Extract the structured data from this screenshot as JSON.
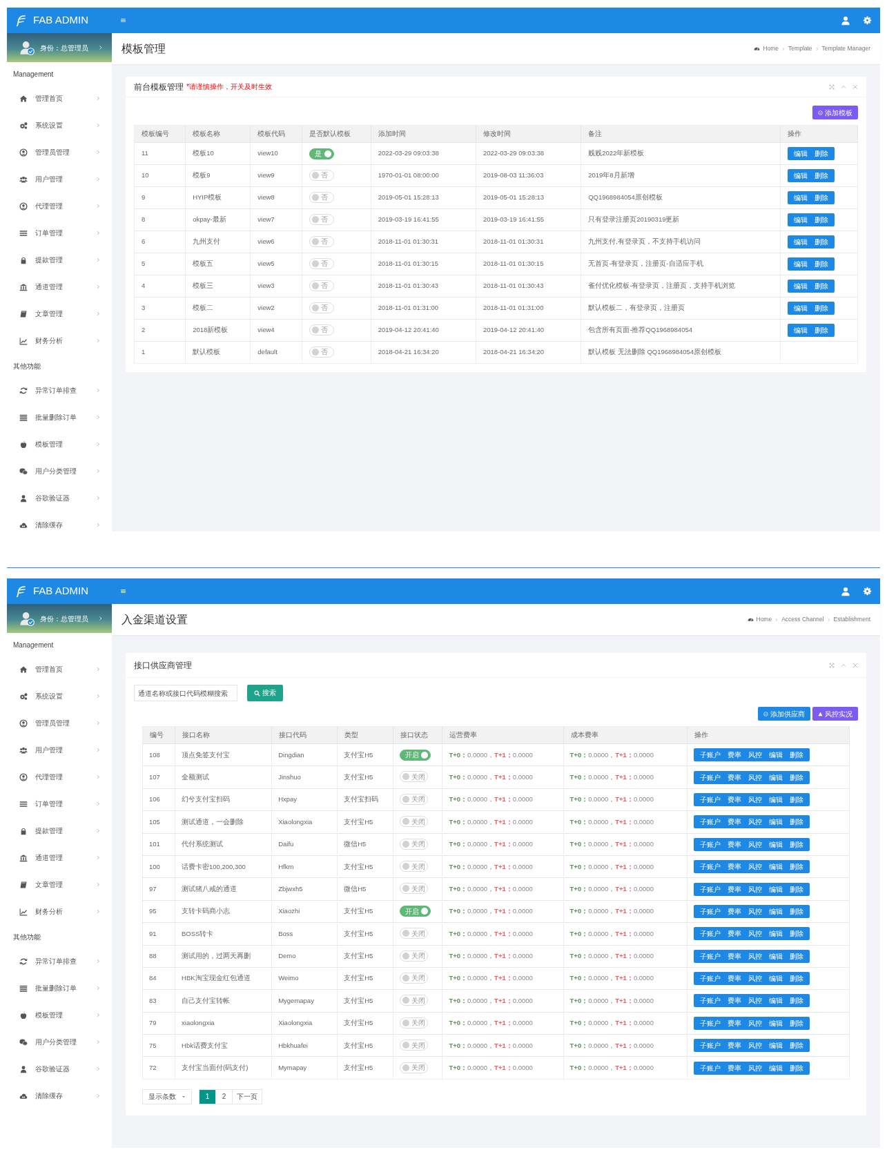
{
  "screens": [
    {
      "brand": "FAB ADMIN",
      "identity": "身份：总管理员",
      "sidebar": [
        {
          "heading": "Management",
          "items": [
            "管理首页",
            "系统设置",
            "管理员管理",
            "用户管理",
            "代理管理",
            "订单管理",
            "提款管理",
            "通道管理",
            "文章管理",
            "财务分析"
          ]
        },
        {
          "heading": "其他功能",
          "items": [
            "异常订单排查",
            "批量删除订单",
            "模板管理",
            "用户分类管理",
            "谷歌验证器",
            "清除缓存"
          ]
        }
      ],
      "page_title": "模板管理",
      "breadcrumb": [
        "Home",
        "Template",
        "Template Manager"
      ],
      "panel": {
        "title": "前台模板管理",
        "note": "*请谨慎操作，开关及时生效",
        "buttons": [
          {
            "label": "添加模板",
            "color": "#7c5cf0"
          }
        ],
        "table": {
          "kind": "templates",
          "columns": [
            "模板编号",
            "模板名称",
            "模板代码",
            "是否默认模板",
            "添加时间",
            "修改时间",
            "备注",
            "操作"
          ],
          "rows": [
            {
              "id": "11",
              "name": "模板10",
              "code": "view10",
              "default": true,
              "toggle_label": "是",
              "added": "2022-03-29 09:03:38",
              "modified": "2022-03-29 09:03:38",
              "remark": "贱贱2022年新模板",
              "actions": [
                "编辑",
                "删除"
              ]
            },
            {
              "id": "10",
              "name": "模板9",
              "code": "view9",
              "default": false,
              "toggle_label": "否",
              "added": "1970-01-01 08:00:00",
              "modified": "2019-08-03 11:36:03",
              "remark": "2019年8月新增",
              "actions": [
                "编辑",
                "删除"
              ]
            },
            {
              "id": "9",
              "name": "HYIP模板",
              "code": "view8",
              "default": false,
              "toggle_label": "否",
              "added": "2019-05-01 15:28:13",
              "modified": "2019-05-01 15:28:13",
              "remark": "QQ1968984054原创模板",
              "actions": [
                "编辑",
                "删除"
              ]
            },
            {
              "id": "8",
              "name": "okpay-最新",
              "code": "view7",
              "default": false,
              "toggle_label": "否",
              "added": "2019-03-19 16:41:55",
              "modified": "2019-03-19 16:41:55",
              "remark": "只有登录注册页20190319更新",
              "actions": [
                "编辑",
                "删除"
              ]
            },
            {
              "id": "6",
              "name": "九州支付",
              "code": "view6",
              "default": false,
              "toggle_label": "否",
              "added": "2018-11-01 01:30:31",
              "modified": "2018-11-01 01:30:31",
              "remark": "九州支付,有登录页，不支持手机访问",
              "actions": [
                "编辑",
                "删除"
              ]
            },
            {
              "id": "5",
              "name": "模板五",
              "code": "view5",
              "default": false,
              "toggle_label": "否",
              "added": "2018-11-01 01:30:15",
              "modified": "2018-11-01 01:30:15",
              "remark": "无首页-有登录页，注册页-自适应手机",
              "actions": [
                "编辑",
                "删除"
              ]
            },
            {
              "id": "4",
              "name": "模板三",
              "code": "view3",
              "default": false,
              "toggle_label": "否",
              "added": "2018-11-01 01:30:43",
              "modified": "2018-11-01 01:30:43",
              "remark": "雀付优化模板-有登录页，注册页，支持手机浏览",
              "actions": [
                "编辑",
                "删除"
              ]
            },
            {
              "id": "3",
              "name": "模板二",
              "code": "view2",
              "default": false,
              "toggle_label": "否",
              "added": "2018-11-01 01:31:00",
              "modified": "2018-11-01 01:31:00",
              "remark": "默认模板二，有登录页，注册页",
              "actions": [
                "编辑",
                "删除"
              ]
            },
            {
              "id": "2",
              "name": "2018新模板",
              "code": "view4",
              "default": false,
              "toggle_label": "否",
              "added": "2019-04-12 20:41:40",
              "modified": "2019-04-12 20:41:40",
              "remark": "包含所有页面-推荐QQ1968984054",
              "actions": [
                "编辑",
                "删除"
              ]
            },
            {
              "id": "1",
              "name": "默认模板",
              "code": "default",
              "default": false,
              "toggle_label": "否",
              "added": "2018-04-21 16:34:20",
              "modified": "2018-04-21 16:34:20",
              "remark": "默认模板 无法删除 QQ1968984054原创模板"
            }
          ]
        }
      }
    },
    {
      "brand": "FAB ADMIN",
      "identity": "身份：总管理员",
      "sidebar": [
        {
          "heading": "Management",
          "items": [
            "管理首页",
            "系统设置",
            "管理员管理",
            "用户管理",
            "代理管理",
            "订单管理",
            "提款管理",
            "通道管理",
            "文章管理",
            "财务分析"
          ]
        },
        {
          "heading": "其他功能",
          "items": [
            "异常订单排查",
            "批量删除订单",
            "模板管理",
            "用户分类管理",
            "谷歌验证器",
            "清除缓存"
          ]
        }
      ],
      "page_title": "入金渠道设置",
      "breadcrumb": [
        "Home",
        "Access Channel",
        "Establishment"
      ],
      "panel": {
        "title": "接口供应商管理",
        "search": {
          "placeholder": "通道名称或接口代码模糊搜索",
          "button": "搜索"
        },
        "buttons": [
          {
            "label": "添加供应商",
            "color": "#1e88e5"
          },
          {
            "label": "风控实况",
            "color": "#7c5cf0"
          }
        ],
        "table": {
          "kind": "channels",
          "columns": [
            "编号",
            "接口名称",
            "接口代码",
            "类型",
            "接口状态",
            "运营费率",
            "成本费率",
            "操作"
          ],
          "rows": [
            {
              "id": "108",
              "name": "顶点免签支付宝",
              "code": "Dingdian",
              "type": "支付宝H5",
              "enabled": true,
              "toggle_label": "开启",
              "operating_rate": [
                {
                  "label": "T+0：",
                  "value": "0.0000，"
                },
                {
                  "label": "T+1：",
                  "value": "0.0000"
                }
              ],
              "cost_rate": [
                {
                  "label": "T+0：",
                  "value": "0.0000，"
                },
                {
                  "label": "T+1：",
                  "value": "0.0000"
                }
              ],
              "actions": [
                "子账户",
                "费率",
                "风控",
                "编辑",
                "删除"
              ]
            },
            {
              "id": "107",
              "name": "全额测试",
              "code": "Jinshuo",
              "type": "支付宝H5",
              "enabled": false,
              "toggle_label": "关闭",
              "operating_rate": [
                {
                  "label": "T+0：",
                  "value": "0.0000，"
                },
                {
                  "label": "T+1：",
                  "value": "0.0000"
                }
              ],
              "cost_rate": [
                {
                  "label": "T+0：",
                  "value": "0.0000，"
                },
                {
                  "label": "T+1：",
                  "value": "0.0000"
                }
              ],
              "actions": [
                "子账户",
                "费率",
                "风控",
                "编辑",
                "删除"
              ]
            },
            {
              "id": "106",
              "name": "幻兮支付宝扫码",
              "code": "Hxpay",
              "type": "支付宝扫码",
              "enabled": false,
              "toggle_label": "关闭",
              "operating_rate": [
                {
                  "label": "T+0：",
                  "value": "0.0000，"
                },
                {
                  "label": "T+1：",
                  "value": "0.0000"
                }
              ],
              "cost_rate": [
                {
                  "label": "T+0：",
                  "value": "0.0000，"
                },
                {
                  "label": "T+1：",
                  "value": "0.0000"
                }
              ],
              "actions": [
                "子账户",
                "费率",
                "风控",
                "编辑",
                "删除"
              ]
            },
            {
              "id": "105",
              "name": "测试通道，一会删除",
              "code": "Xiaolongxia",
              "type": "支付宝H5",
              "enabled": false,
              "toggle_label": "关闭",
              "operating_rate": [
                {
                  "label": "T+0：",
                  "value": "0.0000，"
                },
                {
                  "label": "T+1：",
                  "value": "0.0000"
                }
              ],
              "cost_rate": [
                {
                  "label": "T+0：",
                  "value": "0.0000，"
                },
                {
                  "label": "T+1：",
                  "value": "0.0000"
                }
              ],
              "actions": [
                "子账户",
                "费率",
                "风控",
                "编辑",
                "删除"
              ]
            },
            {
              "id": "101",
              "name": "代付系统测试",
              "code": "Daifu",
              "type": "微信H5",
              "enabled": false,
              "toggle_label": "关闭",
              "operating_rate": [
                {
                  "label": "T+0：",
                  "value": "0.0000，"
                },
                {
                  "label": "T+1：",
                  "value": "0.0000"
                }
              ],
              "cost_rate": [
                {
                  "label": "T+0：",
                  "value": "0.0000，"
                },
                {
                  "label": "T+1：",
                  "value": "0.0000"
                }
              ],
              "actions": [
                "子账户",
                "费率",
                "风控",
                "编辑",
                "删除"
              ]
            },
            {
              "id": "100",
              "name": "话费卡密100,200,300",
              "code": "Hfkm",
              "type": "支付宝H5",
              "enabled": false,
              "toggle_label": "关闭",
              "operating_rate": [
                {
                  "label": "T+0：",
                  "value": "0.0000，"
                },
                {
                  "label": "T+1：",
                  "value": "0.0000"
                }
              ],
              "cost_rate": [
                {
                  "label": "T+0：",
                  "value": "0.0000，"
                },
                {
                  "label": "T+1：",
                  "value": "0.0000"
                }
              ],
              "actions": [
                "子账户",
                "费率",
                "风控",
                "编辑",
                "删除"
              ]
            },
            {
              "id": "97",
              "name": "测试猪八戒的通道",
              "code": "Zbjwxh5",
              "type": "微信H5",
              "enabled": false,
              "toggle_label": "关闭",
              "operating_rate": [
                {
                  "label": "T+0：",
                  "value": "0.0000，"
                },
                {
                  "label": "T+1：",
                  "value": "0.0000"
                }
              ],
              "cost_rate": [
                {
                  "label": "T+0：",
                  "value": "0.0000，"
                },
                {
                  "label": "T+1：",
                  "value": "0.0000"
                }
              ],
              "actions": [
                "子账户",
                "费率",
                "风控",
                "编辑",
                "删除"
              ]
            },
            {
              "id": "95",
              "name": "支转卡码商小志",
              "code": "Xiaozhi",
              "type": "支付宝H5",
              "enabled": true,
              "toggle_label": "开启",
              "operating_rate": [
                {
                  "label": "T+0：",
                  "value": "0.0000，"
                },
                {
                  "label": "T+1：",
                  "value": "0.0000"
                }
              ],
              "cost_rate": [
                {
                  "label": "T+0：",
                  "value": "0.0000，"
                },
                {
                  "label": "T+1：",
                  "value": "0.0000"
                }
              ],
              "actions": [
                "子账户",
                "费率",
                "风控",
                "编辑",
                "删除"
              ]
            },
            {
              "id": "91",
              "name": "BOSS转卡",
              "code": "Boss",
              "type": "支付宝H5",
              "enabled": false,
              "toggle_label": "关闭",
              "operating_rate": [
                {
                  "label": "T+0：",
                  "value": "0.0000，"
                },
                {
                  "label": "T+1：",
                  "value": "0.0000"
                }
              ],
              "cost_rate": [
                {
                  "label": "T+0：",
                  "value": "0.0000，"
                },
                {
                  "label": "T+1：",
                  "value": "0.0000"
                }
              ],
              "actions": [
                "子账户",
                "费率",
                "风控",
                "编辑",
                "删除"
              ]
            },
            {
              "id": "88",
              "name": "测试用的，过两天再删",
              "code": "Demo",
              "type": "支付宝H5",
              "enabled": false,
              "toggle_label": "关闭",
              "operating_rate": [
                {
                  "label": "T+0：",
                  "value": "0.0000，"
                },
                {
                  "label": "T+1：",
                  "value": "0.0000"
                }
              ],
              "cost_rate": [
                {
                  "label": "T+0：",
                  "value": "0.0000，"
                },
                {
                  "label": "T+1：",
                  "value": "0.0000"
                }
              ],
              "actions": [
                "子账户",
                "费率",
                "风控",
                "编辑",
                "删除"
              ]
            },
            {
              "id": "84",
              "name": "HBK淘宝现金红包通道",
              "code": "Weimo",
              "type": "支付宝H5",
              "enabled": false,
              "toggle_label": "关闭",
              "operating_rate": [
                {
                  "label": "T+0：",
                  "value": "0.0000，"
                },
                {
                  "label": "T+1：",
                  "value": "0.0000"
                }
              ],
              "cost_rate": [
                {
                  "label": "T+0：",
                  "value": "0.0000，"
                },
                {
                  "label": "T+1：",
                  "value": "0.0000"
                }
              ],
              "actions": [
                "子账户",
                "费率",
                "风控",
                "编辑",
                "删除"
              ]
            },
            {
              "id": "83",
              "name": "自己支付宝转帐",
              "code": "Mygemapay",
              "type": "支付宝H5",
              "enabled": false,
              "toggle_label": "关闭",
              "operating_rate": [
                {
                  "label": "T+0：",
                  "value": "0.0000，"
                },
                {
                  "label": "T+1：",
                  "value": "0.0000"
                }
              ],
              "cost_rate": [
                {
                  "label": "T+0：",
                  "value": "0.0000，"
                },
                {
                  "label": "T+1：",
                  "value": "0.0000"
                }
              ],
              "actions": [
                "子账户",
                "费率",
                "风控",
                "编辑",
                "删除"
              ]
            },
            {
              "id": "79",
              "name": "xiaolongxia",
              "code": "Xiaolongxia",
              "type": "支付宝H5",
              "enabled": false,
              "toggle_label": "关闭",
              "operating_rate": [
                {
                  "label": "T+0：",
                  "value": "0.0000，"
                },
                {
                  "label": "T+1：",
                  "value": "0.0000"
                }
              ],
              "cost_rate": [
                {
                  "label": "T+0：",
                  "value": "0.0000，"
                },
                {
                  "label": "T+1：",
                  "value": "0.0000"
                }
              ],
              "actions": [
                "子账户",
                "费率",
                "风控",
                "编辑",
                "删除"
              ]
            },
            {
              "id": "75",
              "name": "Hbk话费支付宝",
              "code": "Hbkhuafei",
              "type": "支付宝H5",
              "enabled": false,
              "toggle_label": "关闭",
              "operating_rate": [
                {
                  "label": "T+0：",
                  "value": "0.0000，"
                },
                {
                  "label": "T+1：",
                  "value": "0.0000"
                }
              ],
              "cost_rate": [
                {
                  "label": "T+0：",
                  "value": "0.0000，"
                },
                {
                  "label": "T+1：",
                  "value": "0.0000"
                }
              ],
              "actions": [
                "子账户",
                "费率",
                "风控",
                "编辑",
                "删除"
              ]
            },
            {
              "id": "72",
              "name": "支付宝当面付(码支付)",
              "code": "Mymapay",
              "type": "支付宝H5",
              "enabled": false,
              "toggle_label": "关闭",
              "operating_rate": [
                {
                  "label": "T+0：",
                  "value": "0.0000，"
                },
                {
                  "label": "T+1：",
                  "value": "0.0000"
                }
              ],
              "cost_rate": [
                {
                  "label": "T+0：",
                  "value": "0.0000，"
                },
                {
                  "label": "T+1：",
                  "value": "0.0000"
                }
              ],
              "actions": [
                "子账户",
                "费率",
                "风控",
                "编辑",
                "删除"
              ]
            }
          ]
        },
        "pagination": {
          "page_size_label": "显示条数",
          "pages": [
            {
              "label": "1",
              "selected": true
            },
            {
              "label": "2",
              "selected": false
            }
          ],
          "next": "下一页"
        }
      }
    }
  ]
}
